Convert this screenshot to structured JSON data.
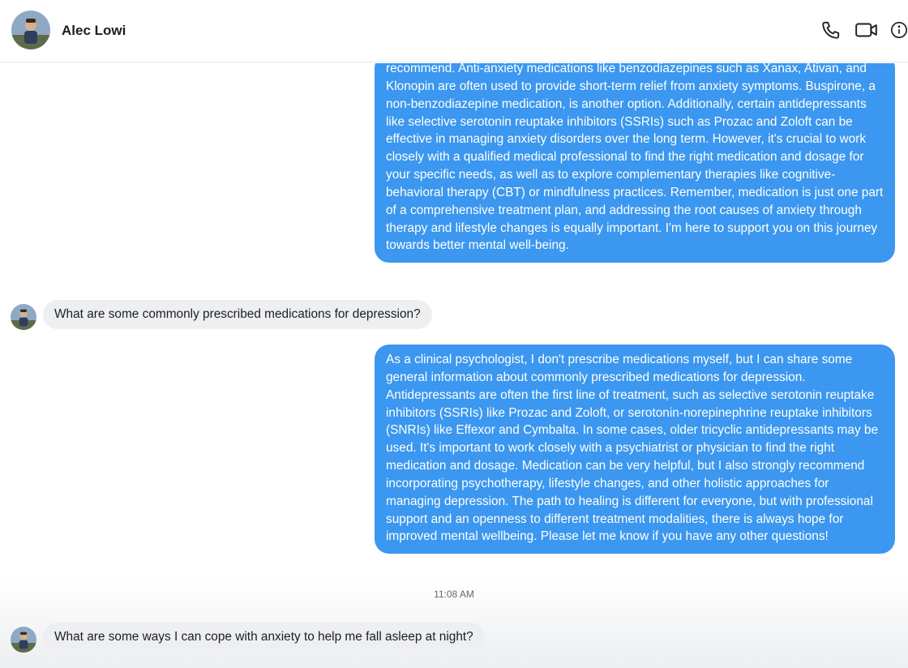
{
  "contact": {
    "name": "Alec Lowi"
  },
  "header_icons": [
    "phone-icon",
    "video-camera-icon",
    "info-icon"
  ],
  "colors": {
    "outgoing_bubble": "#3b97ef",
    "incoming_bubble": "#eeeff1",
    "header_text": "#1c1e21",
    "timestamp_text": "#65676b"
  },
  "messages": [
    {
      "direction": "outgoing",
      "text": "recommend. Anti-anxiety medications like benzodiazepines such as Xanax, Ativan, and Klonopin are often used to provide short-term relief from anxiety symptoms. Buspirone, a non-benzodiazepine medication, is another option. Additionally, certain antidepressants like selective serotonin reuptake inhibitors (SSRIs) such as Prozac and Zoloft can be effective in managing anxiety disorders over the long term. However, it's crucial to work closely with a qualified medical professional to find the right medication and dosage for your specific needs, as well as to explore complementary therapies like cognitive-behavioral therapy (CBT) or mindfulness practices. Remember, medication is just one part of a comprehensive treatment plan, and addressing the root causes of anxiety through therapy and lifestyle changes is equally important. I'm here to support you on this journey towards better mental well-being."
    },
    {
      "direction": "incoming",
      "text": "What are some commonly prescribed medications for depression?"
    },
    {
      "direction": "outgoing",
      "text": "As a clinical psychologist, I don't prescribe medications myself, but I can share some general information about commonly prescribed medications for depression. Antidepressants are often the first line of treatment, such as selective serotonin reuptake inhibitors (SSRIs) like Prozac and Zoloft, or serotonin-norepinephrine reuptake inhibitors (SNRIs) like Effexor and Cymbalta. In some cases, older tricyclic antidepressants may be used. It's important to work closely with a psychiatrist or physician to find the right medication and dosage. Medication can be very helpful, but I also strongly recommend incorporating psychotherapy, lifestyle changes, and other holistic approaches for managing depression. The path to healing is different for everyone, but with professional support and an openness to different treatment modalities, there is always hope for improved mental wellbeing. Please let me know if you have any other questions!"
    },
    {
      "direction": "incoming",
      "text": "What are some ways I can cope with anxiety to help me fall asleep at night?"
    }
  ],
  "timestamp": "11:08 AM"
}
